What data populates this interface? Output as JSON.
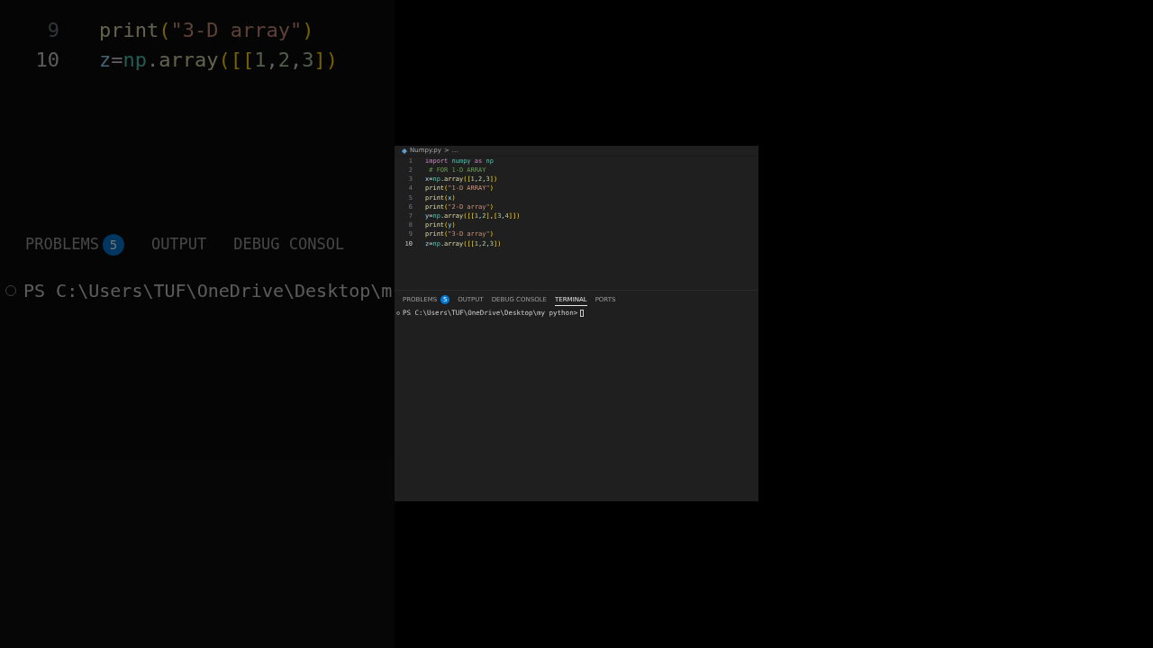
{
  "background": {
    "code_lines": [
      {
        "number": "9",
        "text": "print(\"3-D array\")",
        "active": false
      },
      {
        "number": "10",
        "text": "z=np.array([[1,2,3])",
        "active": true
      }
    ],
    "panel_tabs": [
      {
        "label": "PROBLEMS",
        "badge": "5",
        "selected": false
      },
      {
        "label": "OUTPUT",
        "selected": false
      },
      {
        "label": "DEBUG CONSOL",
        "selected": false
      }
    ],
    "terminal_line": "PS C:\\Users\\TUF\\OneDrive\\Desktop\\m"
  },
  "editor": {
    "breadcrumb": {
      "file": "Numpy.py",
      "separator": ">",
      "rest": "..."
    },
    "code_lines": [
      {
        "number": "1",
        "text": "import numpy as np",
        "active": false
      },
      {
        "number": "2",
        "text": " # FOR 1-D ARRAY",
        "active": false
      },
      {
        "number": "3",
        "text": "x=np.array([1,2,3])",
        "active": false
      },
      {
        "number": "4",
        "text": "print(\"1-D ARRAY\")",
        "active": false
      },
      {
        "number": "5",
        "text": "print(x)",
        "active": false
      },
      {
        "number": "6",
        "text": "print(\"2-D array\")",
        "active": false
      },
      {
        "number": "7",
        "text": "y=np.array([[1,2],[3,4]])",
        "active": false
      },
      {
        "number": "8",
        "text": "print(y)",
        "active": false
      },
      {
        "number": "9",
        "text": "print(\"3-D array\")",
        "active": false
      },
      {
        "number": "10",
        "text": "z=np.array([[1,2,3])",
        "active": true
      }
    ]
  },
  "panel": {
    "tabs": [
      {
        "label": "PROBLEMS",
        "badge": "5",
        "selected": false
      },
      {
        "label": "OUTPUT",
        "selected": false
      },
      {
        "label": "DEBUG CONSOLE",
        "selected": false
      },
      {
        "label": "TERMINAL",
        "selected": true
      },
      {
        "label": "PORTS",
        "selected": false
      }
    ],
    "terminal_line": "PS C:\\Users\\TUF\\OneDrive\\Desktop\\my python>"
  }
}
